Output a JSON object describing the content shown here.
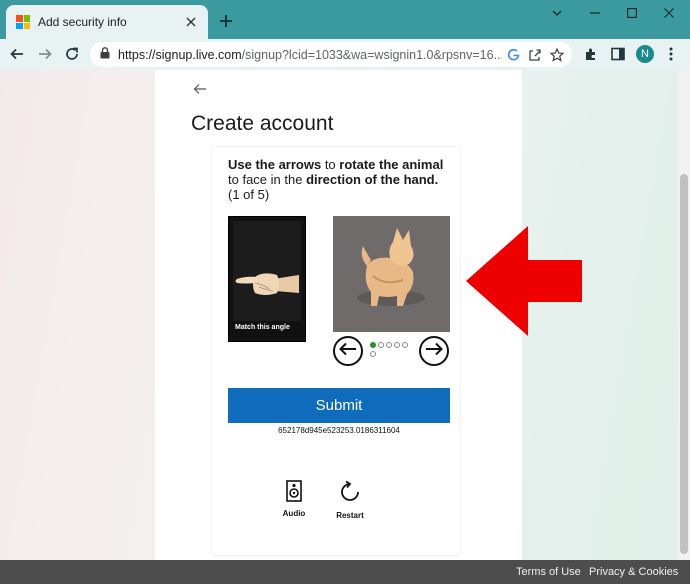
{
  "browser": {
    "tab_title": "Add security info",
    "url_host": "https://signup.live.com",
    "url_rest": "/signup?lcid=1033&wa=wsignin1.0&rpsnv=16...",
    "avatar_letter": "N",
    "colors": {
      "tabbar": "#3b9a9f",
      "toolbar": "#e9f2f3",
      "avatar": "#1a8a8a"
    },
    "icons": [
      "new-tab-icon",
      "minimize-icon",
      "maximize-icon",
      "close-icon",
      "back-arrow-icon",
      "forward-arrow-icon",
      "reload-icon",
      "lock-icon",
      "google-icon",
      "share-icon",
      "star-icon",
      "extensions-icon",
      "sidepanel-icon",
      "menu-dots-icon"
    ]
  },
  "page": {
    "title": "Create account",
    "instruction": {
      "p1": "Use the arrows",
      "p2": " to ",
      "p3": "rotate the animal",
      "p4": " to face in the ",
      "p5": "direction of the hand.",
      "p6": "(1 of 5)"
    },
    "hand_caption": "Match this angle",
    "step": {
      "current": 1,
      "total": 5
    },
    "submit_label": "Submit",
    "code": "652178d945e523253.0186311604",
    "audio_label": "Audio",
    "restart_label": "Restart",
    "accent_color": "#0f6cbd",
    "annotation_arrow_color": "#ee0000"
  },
  "footer": {
    "terms": "Terms of Use",
    "privacy": "Privacy & Cookies"
  }
}
